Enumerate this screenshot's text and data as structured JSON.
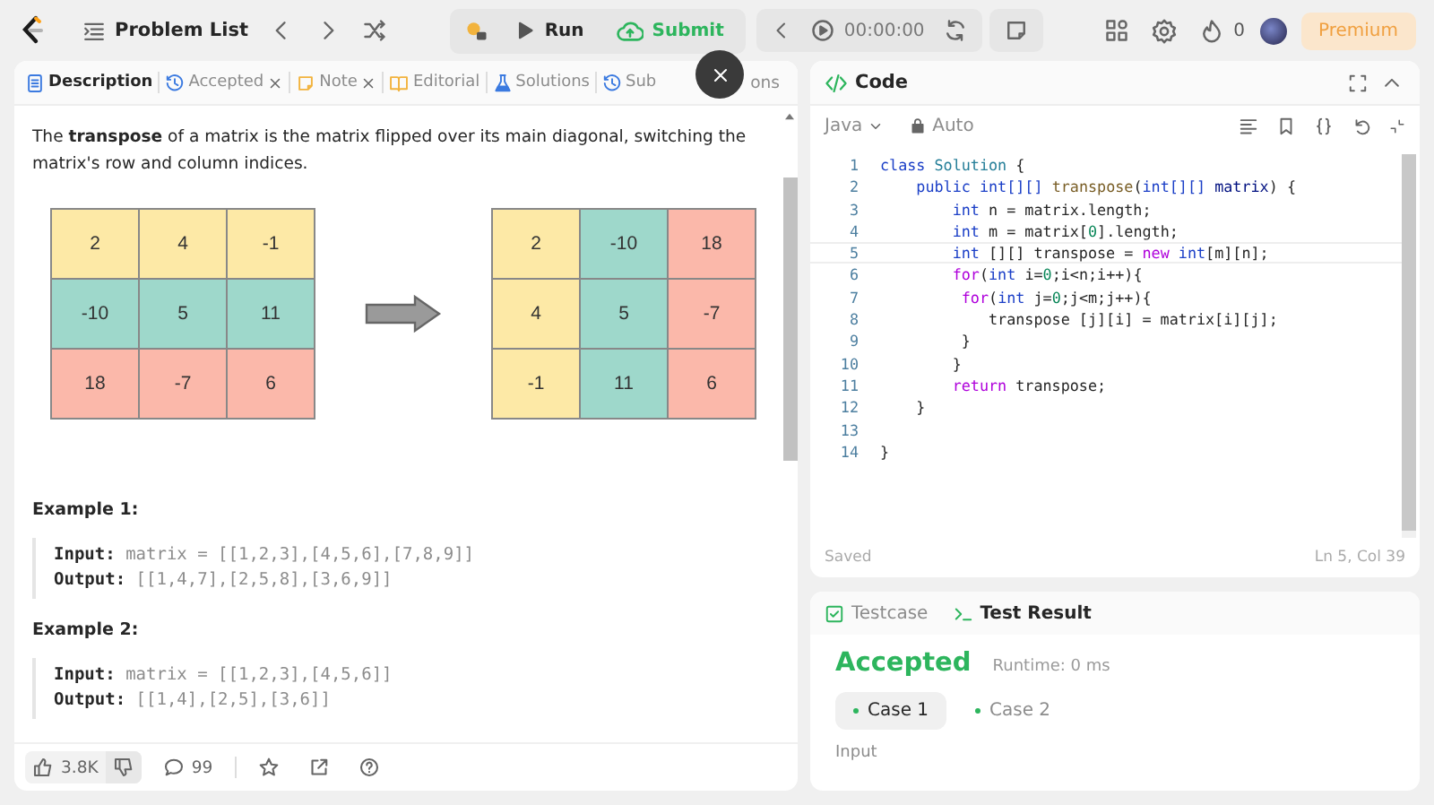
{
  "topbar": {
    "problem_list": "Problem List",
    "run": "Run",
    "submit": "Submit",
    "timer": "00:00:00",
    "streak": "0",
    "premium": "Premium"
  },
  "description": {
    "tabs": [
      {
        "kind": "description",
        "label": "Description",
        "selected": true,
        "closable": false
      },
      {
        "kind": "accepted",
        "label": "Accepted",
        "selected": false,
        "closable": true
      },
      {
        "kind": "note",
        "label": "Note",
        "selected": false,
        "closable": true
      },
      {
        "kind": "editorial",
        "label": "Editorial",
        "selected": false,
        "closable": false
      },
      {
        "kind": "solutions",
        "label": "Solutions",
        "selected": false,
        "closable": false
      },
      {
        "kind": "submissions",
        "label": "Sub",
        "selected": false,
        "closable": false
      }
    ],
    "tab_tail": "ons",
    "intro": "The **transpose** of a matrix is the matrix flipped over its main diagonal, switching the matrix's row and column indices.",
    "matrices": [
      {
        "rows": [
          [
            {
              "value": "2",
              "color": "#fde9a6"
            },
            {
              "value": "4",
              "color": "#fde9a6"
            },
            {
              "value": "-1",
              "color": "#fde9a6"
            }
          ],
          [
            {
              "value": "-10",
              "color": "#9ed8cb"
            },
            {
              "value": "5",
              "color": "#9ed8cb"
            },
            {
              "value": "11",
              "color": "#9ed8cb"
            }
          ],
          [
            {
              "value": "18",
              "color": "#fbb8aa"
            },
            {
              "value": "-7",
              "color": "#fbb8aa"
            },
            {
              "value": "6",
              "color": "#fbb8aa"
            }
          ]
        ]
      },
      {
        "rows": [
          [
            {
              "value": "2",
              "color": "#fde9a6"
            },
            {
              "value": "-10",
              "color": "#9ed8cb"
            },
            {
              "value": "18",
              "color": "#fbb8aa"
            }
          ],
          [
            {
              "value": "4",
              "color": "#fde9a6"
            },
            {
              "value": "5",
              "color": "#9ed8cb"
            },
            {
              "value": "-7",
              "color": "#fbb8aa"
            }
          ],
          [
            {
              "value": "-1",
              "color": "#fde9a6"
            },
            {
              "value": "11",
              "color": "#9ed8cb"
            },
            {
              "value": "6",
              "color": "#fbb8aa"
            }
          ]
        ]
      }
    ],
    "examples": [
      {
        "title": "Example 1:",
        "input_label": "Input:",
        "input": "matrix = [[1,2,3],[4,5,6],[7,8,9]]",
        "output_label": "Output:",
        "output": "[[1,4,7],[2,5,8],[3,6,9]]"
      },
      {
        "title": "Example 2:",
        "input_label": "Input:",
        "input": "matrix = [[1,2,3],[4,5,6]]",
        "output_label": "Output:",
        "output": "[[1,4],[2,5],[3,6]]"
      }
    ],
    "likes": "3.8K",
    "comments": "99"
  },
  "code": {
    "title": "Code",
    "language": "Java",
    "mode": "Auto",
    "lines": [
      {
        "number": "1",
        "tokens": [
          {
            "kind": "kw",
            "text": "class "
          },
          {
            "kind": "type",
            "text": "Solution"
          },
          {
            "kind": "plain",
            "text": " {"
          }
        ]
      },
      {
        "number": "2",
        "tokens": [
          {
            "kind": "kw",
            "text": "    public "
          },
          {
            "kind": "kw",
            "text": "int[][] "
          },
          {
            "kind": "fn",
            "text": "transpose"
          },
          {
            "kind": "plain",
            "text": "("
          },
          {
            "kind": "kw",
            "text": "int[][] "
          },
          {
            "kind": "var",
            "text": "matrix"
          },
          {
            "kind": "plain",
            "text": ") {"
          }
        ]
      },
      {
        "number": "3",
        "tokens": [
          {
            "kind": "kw",
            "text": "        int"
          },
          {
            "kind": "plain",
            "text": " n = matrix.length;"
          }
        ]
      },
      {
        "number": "4",
        "tokens": [
          {
            "kind": "kw",
            "text": "        int"
          },
          {
            "kind": "plain",
            "text": " m = matrix["
          },
          {
            "kind": "num",
            "text": "0"
          },
          {
            "kind": "plain",
            "text": "].length;"
          }
        ]
      },
      {
        "number": "5",
        "tokens": [
          {
            "kind": "kw",
            "text": "        int"
          },
          {
            "kind": "plain",
            "text": " [][] transpose = "
          },
          {
            "kind": "ctrl",
            "text": "new "
          },
          {
            "kind": "kw",
            "text": "int"
          },
          {
            "kind": "plain",
            "text": "[m][n];"
          }
        ]
      },
      {
        "number": "6",
        "tokens": [
          {
            "kind": "ctrl",
            "text": "        for"
          },
          {
            "kind": "plain",
            "text": "("
          },
          {
            "kind": "kw",
            "text": "int"
          },
          {
            "kind": "plain",
            "text": " i="
          },
          {
            "kind": "num",
            "text": "0"
          },
          {
            "kind": "plain",
            "text": ";i<n;i++){"
          }
        ]
      },
      {
        "number": "7",
        "tokens": [
          {
            "kind": "ctrl",
            "text": "         for"
          },
          {
            "kind": "plain",
            "text": "("
          },
          {
            "kind": "kw",
            "text": "int"
          },
          {
            "kind": "plain",
            "text": " j="
          },
          {
            "kind": "num",
            "text": "0"
          },
          {
            "kind": "plain",
            "text": ";j<m;j++){"
          }
        ]
      },
      {
        "number": "8",
        "tokens": [
          {
            "kind": "plain",
            "text": "            transpose [j][i] = matrix[i][j];"
          }
        ]
      },
      {
        "number": "9",
        "tokens": [
          {
            "kind": "plain",
            "text": "         }"
          }
        ]
      },
      {
        "number": "10",
        "tokens": [
          {
            "kind": "plain",
            "text": "        }"
          }
        ]
      },
      {
        "number": "11",
        "tokens": [
          {
            "kind": "ctrl",
            "text": "        return"
          },
          {
            "kind": "plain",
            "text": " transpose;"
          }
        ]
      },
      {
        "number": "12",
        "tokens": [
          {
            "kind": "plain",
            "text": "    }"
          }
        ]
      },
      {
        "number": "13"
      },
      {
        "number": "14",
        "tokens": [
          {
            "kind": "plain",
            "text": "}"
          }
        ]
      }
    ],
    "status": "Saved",
    "cursor": "Ln 5, Col 39"
  },
  "result": {
    "tabs": [
      {
        "kind": "testcase",
        "label": "Testcase",
        "selected": false
      },
      {
        "kind": "result",
        "label": "Test Result",
        "selected": true
      }
    ],
    "verdict": "Accepted",
    "runtime": "Runtime: 0 ms",
    "cases": [
      {
        "label": "Case 1",
        "selected": true
      },
      {
        "label": "Case 2",
        "selected": false
      }
    ],
    "section": "Input"
  }
}
